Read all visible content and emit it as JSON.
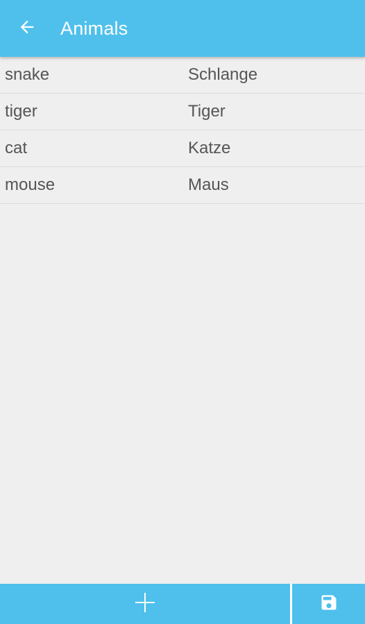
{
  "header": {
    "title": "Animals",
    "back_icon": "arrow-left-icon"
  },
  "vocabulary": [
    {
      "english": "snake",
      "german": "Schlange"
    },
    {
      "english": "tiger",
      "german": "Tiger"
    },
    {
      "english": "cat",
      "german": "Katze"
    },
    {
      "english": "mouse",
      "german": "Maus"
    }
  ],
  "bottom_bar": {
    "add_icon": "plus-icon",
    "save_icon": "floppy-disk-icon"
  },
  "colors": {
    "accent": "#4fc0ec",
    "background": "#efefef",
    "text": "#555555"
  }
}
